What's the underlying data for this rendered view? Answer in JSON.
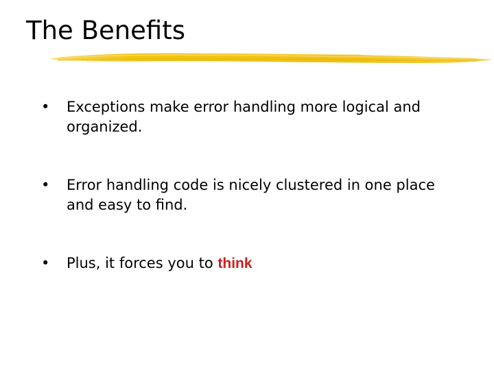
{
  "slide": {
    "title": "The Benefits",
    "accent_color": "#f2c40f",
    "bullets": [
      {
        "text": "Exceptions make error handling more logical and organized."
      },
      {
        "text": "Error handling code is nicely clustered in one place and easy to find."
      },
      {
        "text_before": "Plus, it forces you to",
        "emphasis": "think",
        "emphasis_color": "#cc1f1f"
      }
    ],
    "bullet_glyph": "•"
  }
}
